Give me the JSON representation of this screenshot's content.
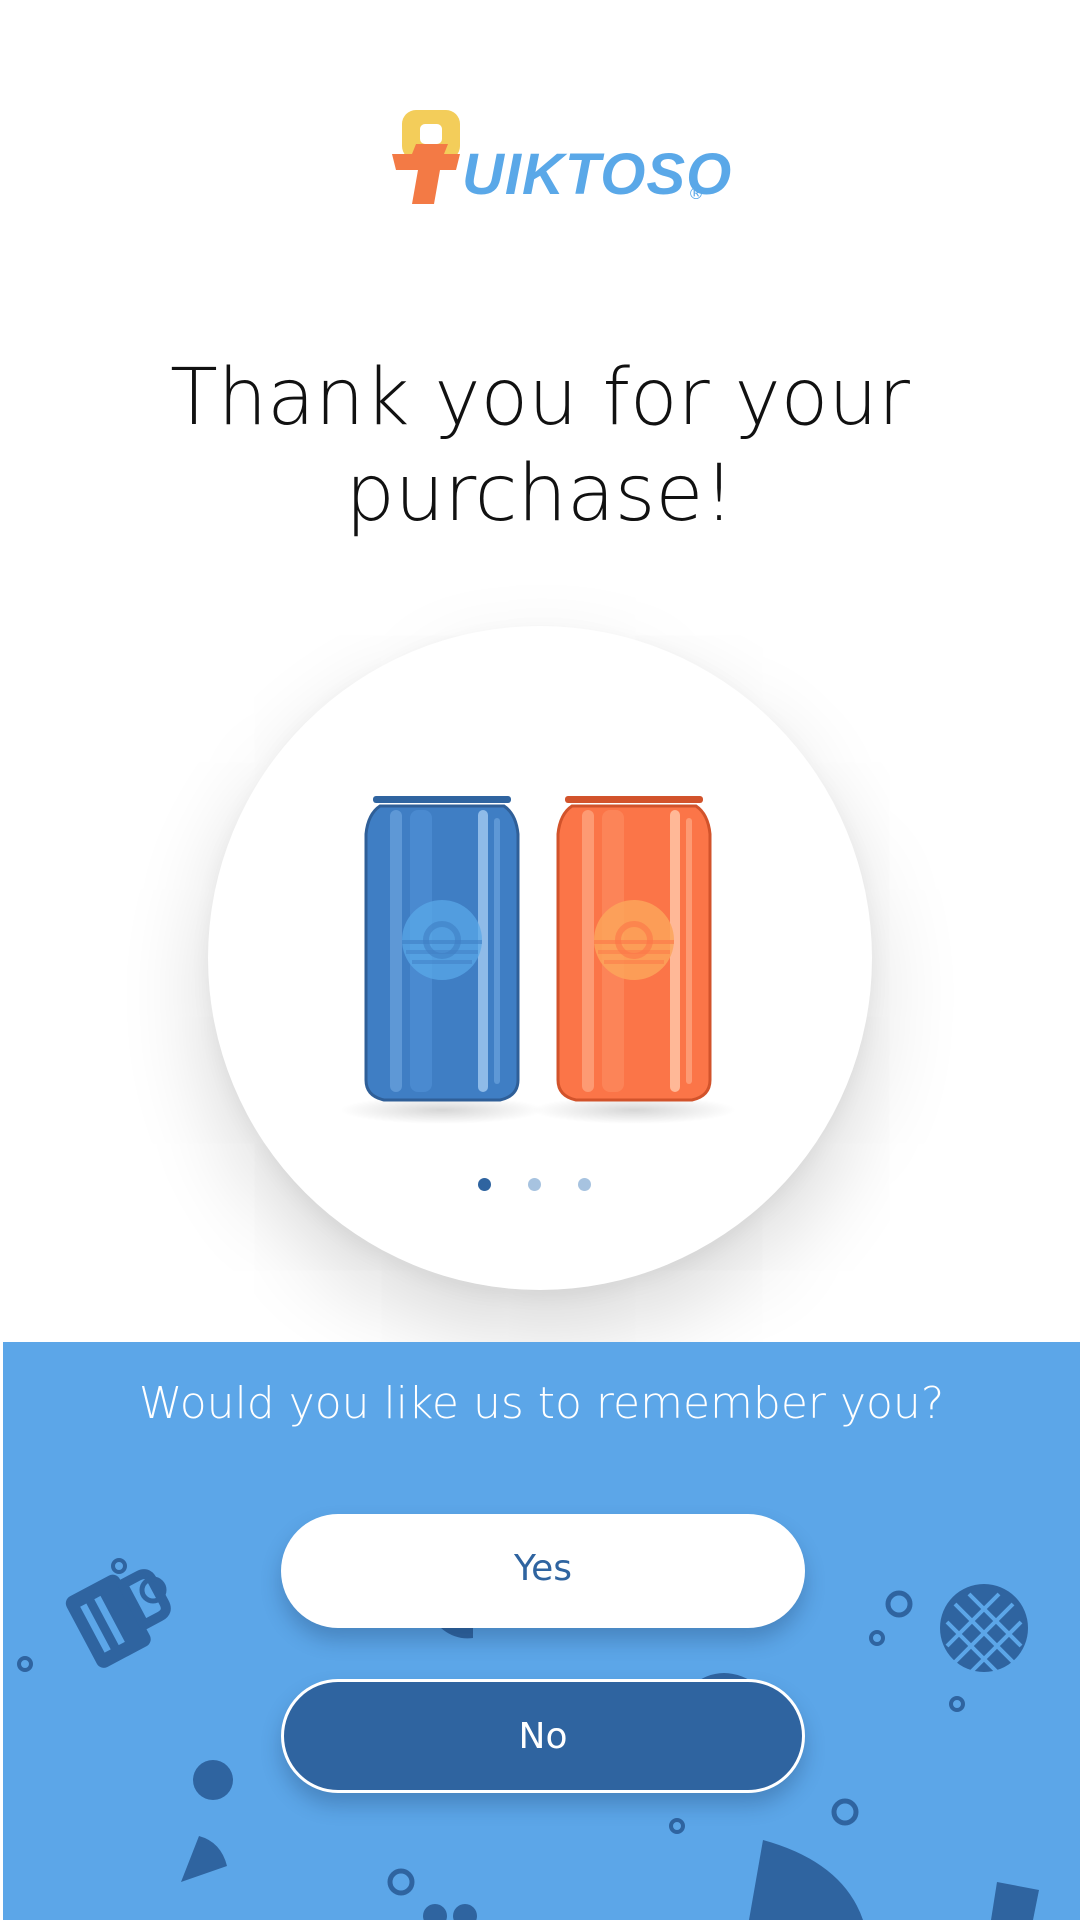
{
  "brand": {
    "logo_text": "UIKTOSO",
    "registered_mark": "®",
    "colors": {
      "mark_yellow": "#f3cd5a",
      "mark_orange": "#f37a45",
      "text_blue": "#5aa8e8"
    }
  },
  "heading": {
    "line1": "Thank you for your",
    "line2": "purchase!"
  },
  "product_carousel": {
    "items": [
      {
        "name": "blue-can",
        "color": "#3f7ec4"
      },
      {
        "name": "orange-can",
        "color": "#f56f45"
      }
    ],
    "dots_total": 3,
    "active_index": 0,
    "colors": {
      "active_dot": "#2f64a0",
      "inactive_dot": "#a7c3e0"
    }
  },
  "remember_prompt": {
    "question": "Would you like us to remember you?",
    "yes_label": "Yes",
    "no_label": "No",
    "colors": {
      "panel": "#5ca6e8",
      "pattern": "#2f64a0"
    }
  }
}
